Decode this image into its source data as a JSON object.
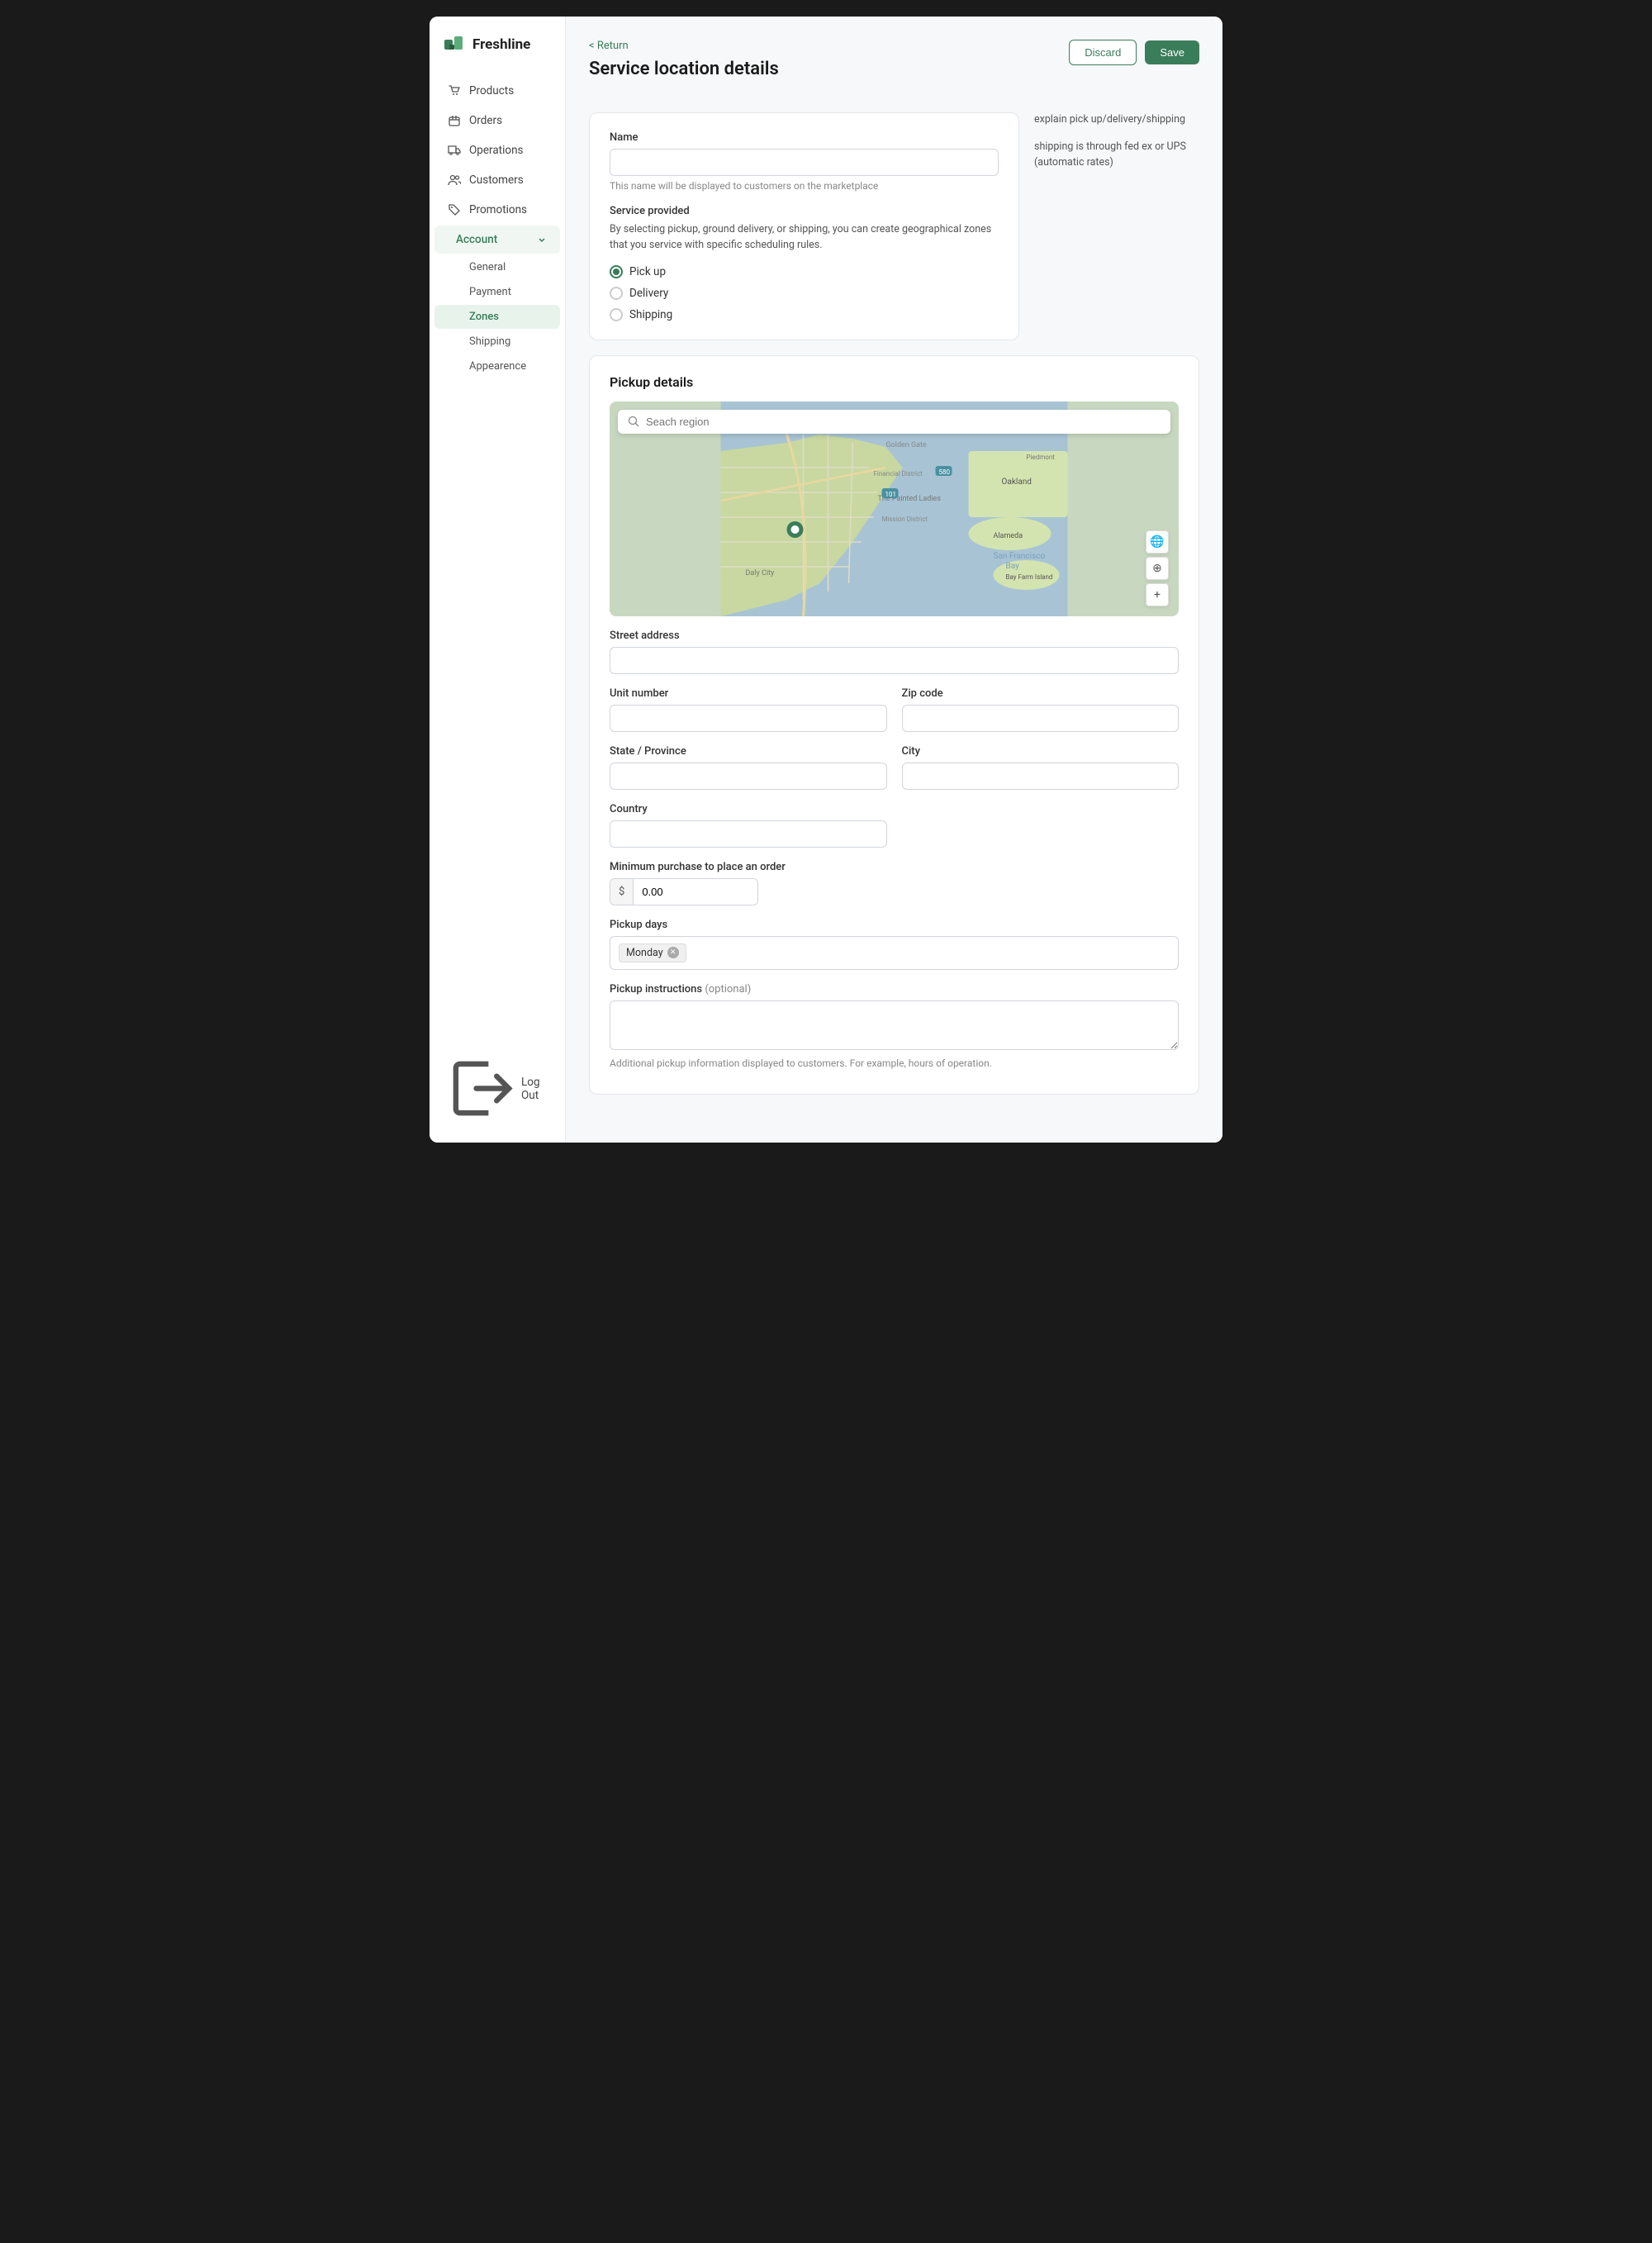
{
  "app": {
    "name": "Freshline"
  },
  "sidebar": {
    "nav_items": [
      {
        "id": "products",
        "label": "Products",
        "icon": "cart"
      },
      {
        "id": "orders",
        "label": "Orders",
        "icon": "box"
      },
      {
        "id": "operations",
        "label": "Operations",
        "icon": "truck"
      },
      {
        "id": "customers",
        "label": "Customers",
        "icon": "people"
      },
      {
        "id": "promotions",
        "label": "Promotions",
        "icon": "tag"
      }
    ],
    "account": {
      "label": "Account",
      "subitems": [
        {
          "id": "general",
          "label": "General"
        },
        {
          "id": "payment",
          "label": "Payment"
        },
        {
          "id": "zones",
          "label": "Zones",
          "active": true
        },
        {
          "id": "shipping",
          "label": "Shipping"
        },
        {
          "id": "appearence",
          "label": "Appearence"
        }
      ]
    },
    "logout": "Log Out"
  },
  "page": {
    "breadcrumb": "< Return",
    "title": "Service location details",
    "discard_btn": "Discard",
    "save_btn": "Save"
  },
  "service_card": {
    "name_label": "Name",
    "name_placeholder": "",
    "name_hint": "This name will be displayed to customers on the marketplace",
    "service_provided_label": "Service provided",
    "service_desc": "By selecting pickup, ground delivery, or shipping, you can create geographical zones that you service with specific scheduling rules.",
    "options": [
      {
        "id": "pickup",
        "label": "Pick up",
        "checked": true
      },
      {
        "id": "delivery",
        "label": "Delivery",
        "checked": false
      },
      {
        "id": "shipping",
        "label": "Shipping",
        "checked": false
      }
    ]
  },
  "right_hint": {
    "line1": "explain pick up/delivery/shipping",
    "line2": "shipping is through fed ex or UPS (automatic rates)"
  },
  "pickup_card": {
    "title": "Pickup details",
    "map_search_placeholder": "Seach region",
    "street_address_label": "Street address",
    "street_address_value": "",
    "unit_number_label": "Unit number",
    "unit_number_value": "",
    "zip_code_label": "Zip code",
    "zip_code_value": "",
    "state_label": "State / Province",
    "state_value": "",
    "city_label": "City",
    "city_value": "",
    "country_label": "Country",
    "country_value": "",
    "min_purchase_label": "Minimum purchase to place an order",
    "min_purchase_prefix": "$",
    "min_purchase_value": "0.00",
    "pickup_days_label": "Pickup days",
    "pickup_days_tag": "Monday",
    "pickup_instructions_label": "Pickup instructions",
    "pickup_instructions_optional": "(optional)",
    "pickup_instructions_value": "",
    "pickup_instructions_hint": "Additional pickup information displayed to customers. For example, hours of operation."
  }
}
